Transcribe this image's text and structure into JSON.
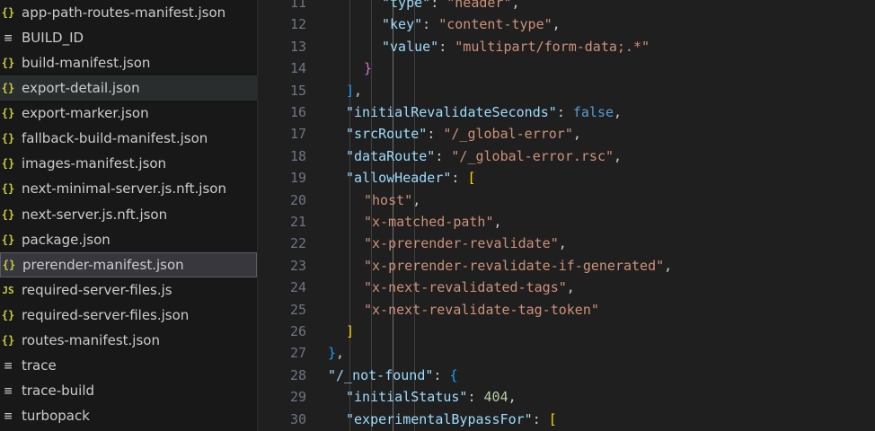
{
  "explorer": {
    "files": [
      {
        "name": "app-path-routes-manifest.json",
        "icon": "json-braces-icon",
        "icon_glyph": "{}",
        "state": ""
      },
      {
        "name": "BUILD_ID",
        "icon": "plain-file-icon",
        "icon_glyph": "≡",
        "state": ""
      },
      {
        "name": "build-manifest.json",
        "icon": "json-braces-icon",
        "icon_glyph": "{}",
        "state": ""
      },
      {
        "name": "export-detail.json",
        "icon": "json-braces-icon",
        "icon_glyph": "{}",
        "state": "hover"
      },
      {
        "name": "export-marker.json",
        "icon": "json-braces-icon",
        "icon_glyph": "{}",
        "state": ""
      },
      {
        "name": "fallback-build-manifest.json",
        "icon": "json-braces-icon",
        "icon_glyph": "{}",
        "state": ""
      },
      {
        "name": "images-manifest.json",
        "icon": "json-braces-icon",
        "icon_glyph": "{}",
        "state": ""
      },
      {
        "name": "next-minimal-server.js.nft.json",
        "icon": "json-braces-icon",
        "icon_glyph": "{}",
        "state": ""
      },
      {
        "name": "next-server.js.nft.json",
        "icon": "json-braces-icon",
        "icon_glyph": "{}",
        "state": ""
      },
      {
        "name": "package.json",
        "icon": "json-braces-icon",
        "icon_glyph": "{}",
        "state": ""
      },
      {
        "name": "prerender-manifest.json",
        "icon": "json-braces-icon",
        "icon_glyph": "{}",
        "state": "selected"
      },
      {
        "name": "required-server-files.js",
        "icon": "js-file-icon",
        "icon_glyph": "JS",
        "state": ""
      },
      {
        "name": "required-server-files.json",
        "icon": "json-braces-icon",
        "icon_glyph": "{}",
        "state": ""
      },
      {
        "name": "routes-manifest.json",
        "icon": "json-braces-icon",
        "icon_glyph": "{}",
        "state": ""
      },
      {
        "name": "trace",
        "icon": "plain-file-icon",
        "icon_glyph": "≡",
        "state": ""
      },
      {
        "name": "trace-build",
        "icon": "plain-file-icon",
        "icon_glyph": "≡",
        "state": ""
      },
      {
        "name": "turbopack",
        "icon": "plain-file-icon",
        "icon_glyph": "≡",
        "state": ""
      }
    ]
  },
  "editor": {
    "lines": [
      {
        "n": "11",
        "t": [
          [
            "k",
            "\"type\""
          ],
          [
            "p",
            ": "
          ],
          [
            "s",
            "\"header\""
          ],
          [
            "p",
            ","
          ]
        ]
      },
      {
        "n": "12",
        "t": [
          [
            "k",
            "\"key\""
          ],
          [
            "p",
            ": "
          ],
          [
            "s",
            "\"content-type\""
          ],
          [
            "p",
            ","
          ]
        ]
      },
      {
        "n": "13",
        "t": [
          [
            "k",
            "\"value\""
          ],
          [
            "p",
            ": "
          ],
          [
            "s",
            "\"multipart/form-data;.*\""
          ]
        ]
      },
      {
        "n": "14",
        "t": [
          [
            "b2",
            "}"
          ]
        ]
      },
      {
        "n": "15",
        "t": [
          [
            "b3",
            "]"
          ],
          [
            "p",
            ","
          ]
        ]
      },
      {
        "n": "16",
        "t": [
          [
            "k",
            "\"initialRevalidateSeconds\""
          ],
          [
            "p",
            ": "
          ],
          [
            "b",
            "false"
          ],
          [
            "p",
            ","
          ]
        ]
      },
      {
        "n": "17",
        "t": [
          [
            "k",
            "\"srcRoute\""
          ],
          [
            "p",
            ": "
          ],
          [
            "s",
            "\"/_global-error\""
          ],
          [
            "p",
            ","
          ]
        ]
      },
      {
        "n": "18",
        "t": [
          [
            "k",
            "\"dataRoute\""
          ],
          [
            "p",
            ": "
          ],
          [
            "s",
            "\"/_global-error.rsc\""
          ],
          [
            "p",
            ","
          ]
        ]
      },
      {
        "n": "19",
        "t": [
          [
            "k",
            "\"allowHeader\""
          ],
          [
            "p",
            ": "
          ],
          [
            "b1",
            "["
          ]
        ]
      },
      {
        "n": "20",
        "t": [
          [
            "s",
            "\"host\""
          ],
          [
            "p",
            ","
          ]
        ]
      },
      {
        "n": "21",
        "t": [
          [
            "s",
            "\"x-matched-path\""
          ],
          [
            "p",
            ","
          ]
        ]
      },
      {
        "n": "22",
        "t": [
          [
            "s",
            "\"x-prerender-revalidate\""
          ],
          [
            "p",
            ","
          ]
        ]
      },
      {
        "n": "23",
        "t": [
          [
            "s",
            "\"x-prerender-revalidate-if-generated\""
          ],
          [
            "p",
            ","
          ]
        ]
      },
      {
        "n": "24",
        "t": [
          [
            "s",
            "\"x-next-revalidated-tags\""
          ],
          [
            "p",
            ","
          ]
        ]
      },
      {
        "n": "25",
        "t": [
          [
            "s",
            "\"x-next-revalidate-tag-token\""
          ]
        ]
      },
      {
        "n": "26",
        "t": [
          [
            "b1",
            "]"
          ]
        ]
      },
      {
        "n": "27",
        "t": [
          [
            "b3",
            "}"
          ],
          [
            "p",
            ","
          ]
        ]
      },
      {
        "n": "28",
        "t": [
          [
            "k",
            "\"/_not-found\""
          ],
          [
            "p",
            ": "
          ],
          [
            "b3",
            "{"
          ]
        ]
      },
      {
        "n": "29",
        "t": [
          [
            "k",
            "\"initialStatus\""
          ],
          [
            "p",
            ": "
          ],
          [
            "num",
            "404"
          ],
          [
            "p",
            ","
          ]
        ]
      },
      {
        "n": "30",
        "t": [
          [
            "k",
            "\"experimentalBypassFor\""
          ],
          [
            "p",
            ": "
          ],
          [
            "b1",
            "["
          ]
        ]
      }
    ]
  },
  "colors": {
    "editor_bg": "#1f1f1f",
    "sidebar_bg": "#181818",
    "json_key": "#9cdcfe",
    "json_string": "#ce9178",
    "json_number": "#b5cea8",
    "json_boolean": "#569cd6"
  }
}
